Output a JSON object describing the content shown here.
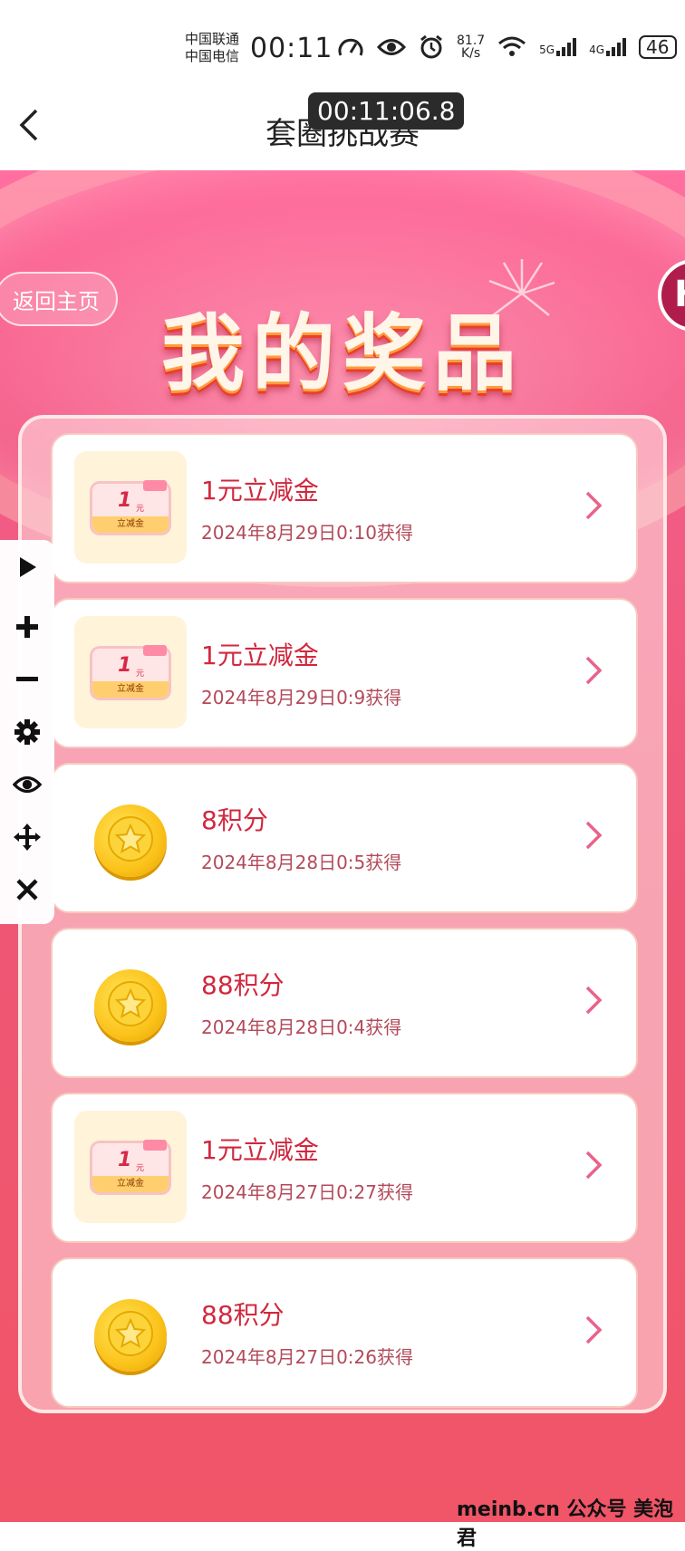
{
  "status_bar": {
    "carrier_1": "中国联通",
    "carrier_2": "中国电信",
    "time": "00:11",
    "speed_value": "81.7",
    "speed_unit": "K/s",
    "net_1": "5G",
    "net_2": "4G",
    "battery": "46"
  },
  "nav": {
    "title": "套圈挑战赛",
    "overlay_time": "00:11:06.8"
  },
  "page": {
    "home_button": "返回主页",
    "banner_title": "我的奖品",
    "right_badge": "H"
  },
  "prizes": [
    {
      "type": "voucher",
      "title": "1元立减金",
      "date": "2024年8月29日0:10获得",
      "voucher_value": "1",
      "voucher_unit": "元",
      "voucher_label": "立减金"
    },
    {
      "type": "voucher",
      "title": "1元立减金",
      "date": "2024年8月29日0:9获得",
      "voucher_value": "1",
      "voucher_unit": "元",
      "voucher_label": "立减金"
    },
    {
      "type": "coin",
      "title": "8积分",
      "date": "2024年8月28日0:5获得"
    },
    {
      "type": "coin",
      "title": "88积分",
      "date": "2024年8月28日0:4获得"
    },
    {
      "type": "voucher",
      "title": "1元立减金",
      "date": "2024年8月27日0:27获得",
      "voucher_value": "1",
      "voucher_unit": "元",
      "voucher_label": "立减金"
    },
    {
      "type": "coin",
      "title": "88积分",
      "date": "2024年8月27日0:26获得"
    }
  ],
  "toolbar": {
    "icons": [
      "play-icon",
      "plus-icon",
      "minus-icon",
      "gear-icon",
      "eye-icon",
      "move-icon",
      "close-icon"
    ]
  },
  "watermark": "meinb.cn  公众号 美泡君",
  "colors": {
    "accent": "#d1283e",
    "page_gradient_top": "#ff6f9f",
    "page_gradient_bottom": "#f05568",
    "chevron": "#e9628a"
  }
}
